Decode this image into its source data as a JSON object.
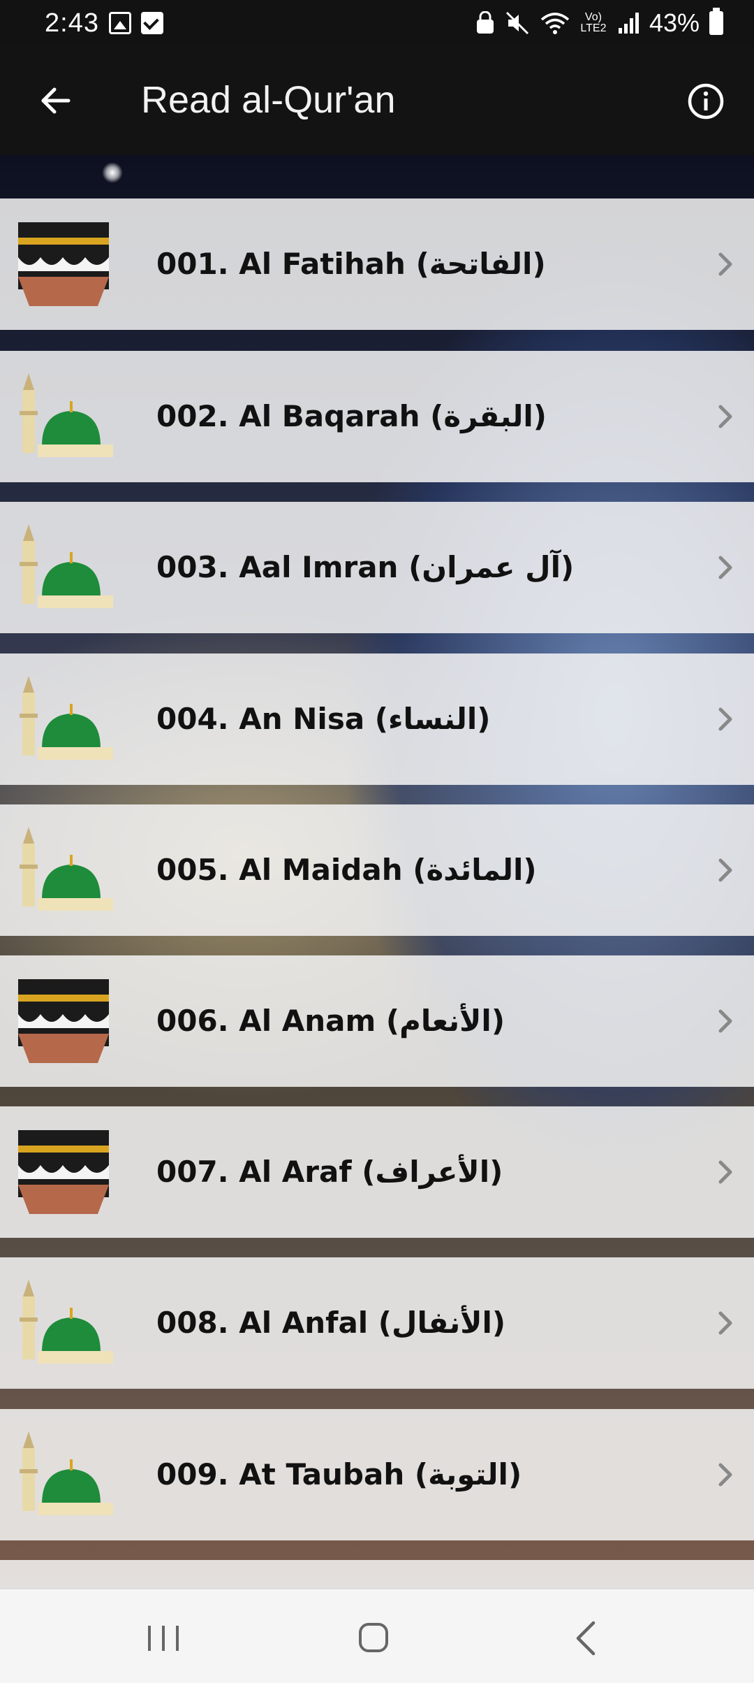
{
  "status_bar": {
    "time": "2:43",
    "network_label": "Vo) LTE2",
    "battery": "43%"
  },
  "app_bar": {
    "title": "Read al-Qur'an"
  },
  "surahs": [
    {
      "label": "001. Al Fatihah (الفاتحة)",
      "icon": "kaaba-icon"
    },
    {
      "label": "002. Al Baqarah (البقرة)",
      "icon": "green-dome-mosque-icon"
    },
    {
      "label": "003. Aal Imran (آل عمران)",
      "icon": "green-dome-mosque-icon"
    },
    {
      "label": "004. An Nisa (النساء)",
      "icon": "green-dome-mosque-icon"
    },
    {
      "label": "005. Al Maidah (المائدة)",
      "icon": "green-dome-mosque-icon"
    },
    {
      "label": "006. Al Anam (الأنعام)",
      "icon": "kaaba-icon"
    },
    {
      "label": "007. Al Araf (الأعراف)",
      "icon": "kaaba-icon"
    },
    {
      "label": "008. Al Anfal (الأنفال)",
      "icon": "green-dome-mosque-icon"
    },
    {
      "label": "009. At Taubah (التوبة)",
      "icon": "green-dome-mosque-icon"
    }
  ],
  "colors": {
    "app_bar": "#131313",
    "row_bg": "#f5f5f5",
    "dome_green": "#1e8c3a",
    "kaaba_gold": "#d9a520"
  }
}
